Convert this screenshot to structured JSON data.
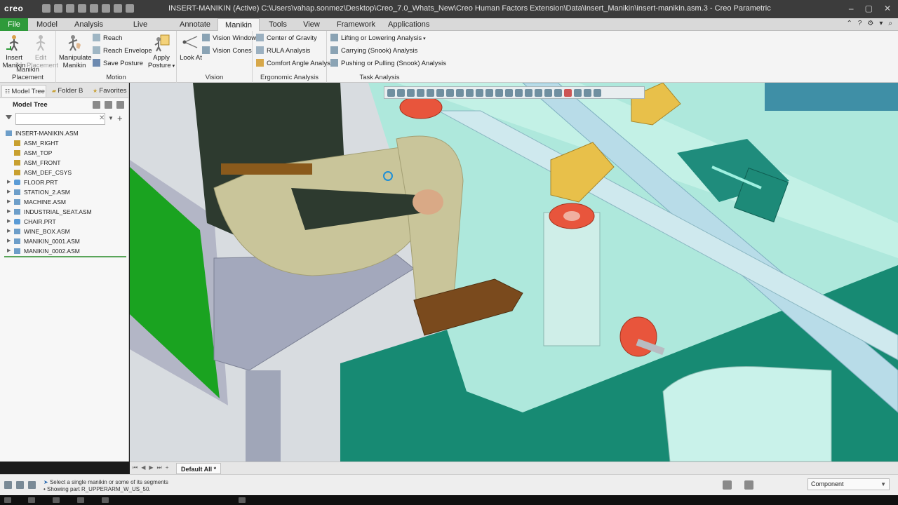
{
  "app": {
    "logo": "creo",
    "window_title": "INSERT-MANIKIN (Active) C:\\Users\\vahap.sonmez\\Desktop\\Creo_7.0_Whats_New\\Creo Human Factors Extension\\Data\\Insert_Manikin\\insert-manikin.asm.3 - Creo Parametric",
    "window_controls": [
      "–",
      "▢",
      "✕"
    ]
  },
  "menu": {
    "file": "File",
    "tabs": [
      "Model",
      "Analysis",
      "Live Simulation",
      "Annotate",
      "Manikin",
      "Tools",
      "View",
      "Framework",
      "Applications"
    ],
    "active_tab": "Manikin"
  },
  "ribbon": {
    "placement": {
      "label": "Manikin Placement",
      "insert": "Insert\nManikin",
      "edit": "Edit\nPlacement"
    },
    "motion": {
      "label": "Motion",
      "manipulate": "Manipulate\nManikin",
      "reach": "Reach",
      "reach_envelope": "Reach Envelope",
      "save_posture": "Save Posture",
      "apply_posture": "Apply\nPosture"
    },
    "vision": {
      "label": "Vision",
      "look_at": "Look At",
      "vision_window": "Vision Window",
      "vision_cones": "Vision Cones"
    },
    "ergonomic": {
      "label": "Ergonomic Analysis",
      "center_of_gravity": "Center of Gravity",
      "rula": "RULA Analysis",
      "comfort": "Comfort Angle Analysis"
    },
    "task": {
      "label": "Task Analysis",
      "lifting": "Lifting or Lowering Analysis",
      "carrying": "Carrying (Snook) Analysis",
      "pushing": "Pushing or Pulling (Snook) Analysis"
    }
  },
  "left_panel": {
    "tabs": [
      "Model Tree",
      "Folder B",
      "Favorites"
    ],
    "tree_header": "Model Tree",
    "search_value": "",
    "tree": [
      {
        "label": "INSERT-MANIKIN.ASM",
        "icon": "assembly-icon",
        "expandable": false,
        "level": 0
      },
      {
        "label": "ASM_RIGHT",
        "icon": "datum-plane-icon",
        "expandable": false,
        "level": 1
      },
      {
        "label": "ASM_TOP",
        "icon": "datum-plane-icon",
        "expandable": false,
        "level": 1
      },
      {
        "label": "ASM_FRONT",
        "icon": "datum-plane-icon",
        "expandable": false,
        "level": 1
      },
      {
        "label": "ASM_DEF_CSYS",
        "icon": "csys-icon",
        "expandable": false,
        "level": 1
      },
      {
        "label": "FLOOR.PRT",
        "icon": "part-icon",
        "expandable": true,
        "level": 1
      },
      {
        "label": "STATION_2.ASM",
        "icon": "assembly-icon",
        "expandable": true,
        "level": 1
      },
      {
        "label": "MACHINE.ASM",
        "icon": "assembly-icon",
        "expandable": true,
        "level": 1
      },
      {
        "label": "INDUSTRIAL_SEAT.ASM",
        "icon": "assembly-icon",
        "expandable": true,
        "level": 1
      },
      {
        "label": "CHAIR.PRT",
        "icon": "part-icon",
        "expandable": true,
        "level": 1
      },
      {
        "label": "WINE_BOX.ASM",
        "icon": "assembly-icon",
        "expandable": true,
        "level": 1
      },
      {
        "label": "MANIKIN_0001.ASM",
        "icon": "assembly-icon",
        "expandable": true,
        "level": 1
      },
      {
        "label": "MANIKIN_0002.ASM",
        "icon": "assembly-icon",
        "expandable": true,
        "level": 1
      }
    ]
  },
  "bottom": {
    "window_tab": "Default All *"
  },
  "status": {
    "message1": "Select a single manikin or some of its segments",
    "message2": "Showing part R_UPPERARM_W_US_50.",
    "filter_value": "Component"
  },
  "colors": {
    "file_tab": "#2e9a3a",
    "title_bar": "#3c3c3c",
    "viewport_bg": "#5fb2a0",
    "machine_teal": "#1d8b78",
    "machine_light": "#bff0e5"
  }
}
